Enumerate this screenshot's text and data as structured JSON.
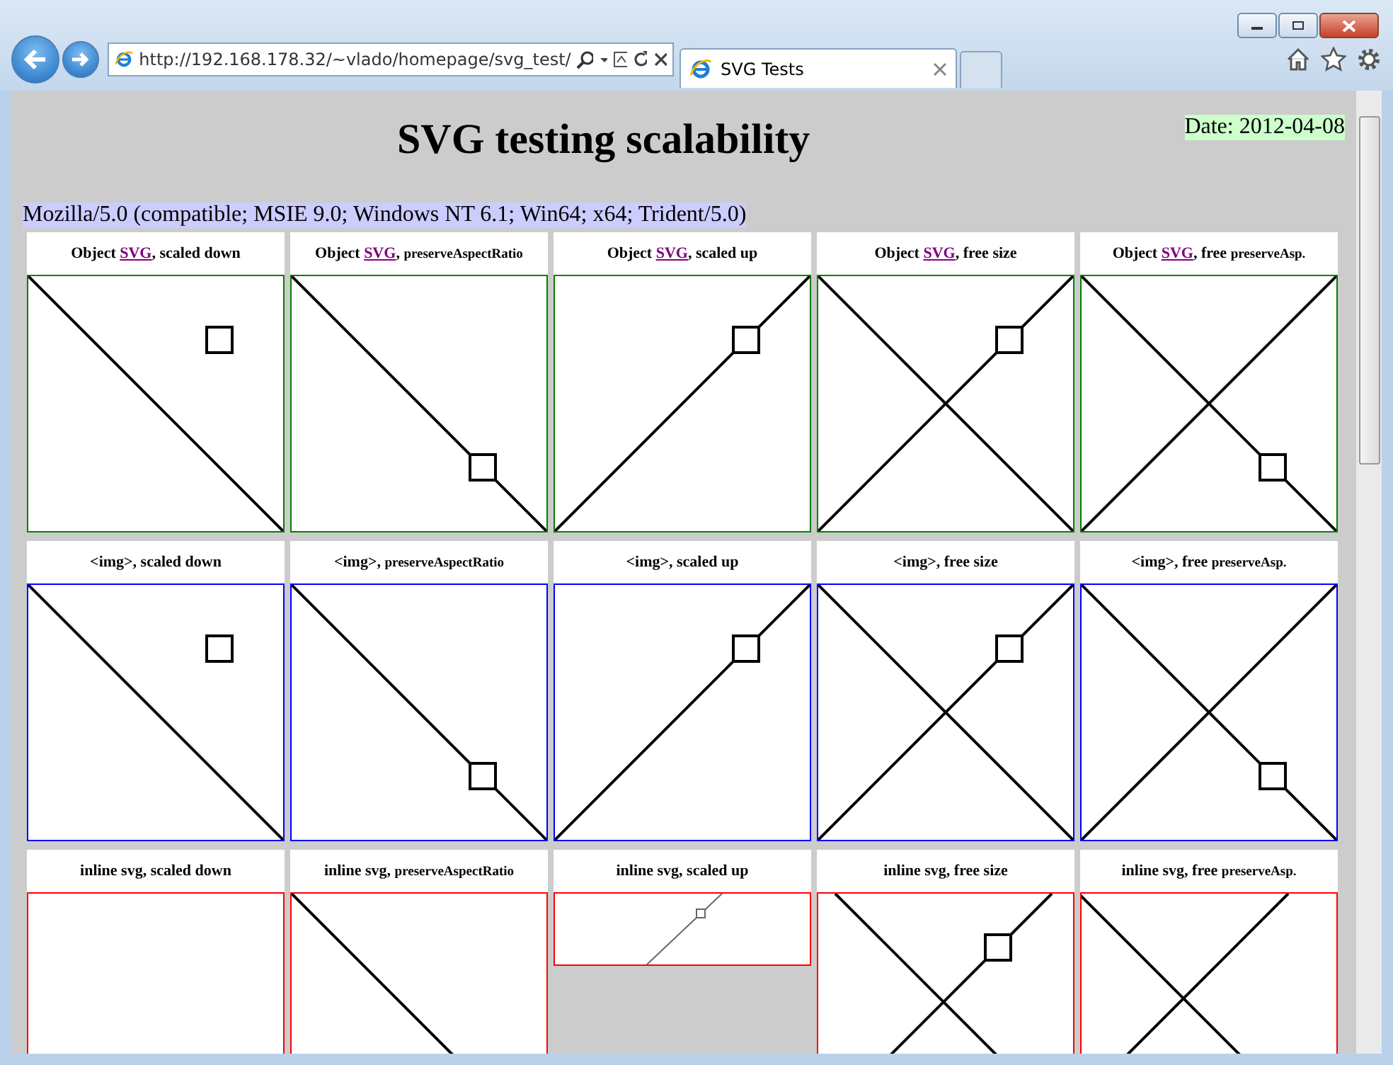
{
  "browser": {
    "url": "http://192.168.178.32/~vlado/homepage/svg_test/",
    "tabs": [
      {
        "title": "SVG Tests",
        "selected": true
      }
    ]
  },
  "page": {
    "title": "SVG testing scalability",
    "date": "Date: 2012-04-08",
    "user_agent": "Mozilla/5.0 (compatible; MSIE 9.0; Windows NT 6.1; Win64; x64; Trident/5.0)",
    "rows": [
      {
        "color": "#008000",
        "cells": [
          {
            "kind": "down",
            "caption": [
              {
                "kind": "text",
                "text": "Object "
              },
              {
                "kind": "link",
                "text": "SVG"
              },
              {
                "kind": "text",
                "text": ", scaled down"
              }
            ]
          },
          {
            "kind": "preserve",
            "caption": [
              {
                "kind": "text",
                "text": "Object "
              },
              {
                "kind": "link",
                "text": "SVG"
              },
              {
                "kind": "text",
                "text": ", "
              },
              {
                "kind": "small",
                "text": "preserveAspectRatio"
              }
            ]
          },
          {
            "kind": "up",
            "caption": [
              {
                "kind": "text",
                "text": "Object "
              },
              {
                "kind": "link",
                "text": "SVG"
              },
              {
                "kind": "text",
                "text": ", scaled up"
              }
            ]
          },
          {
            "kind": "free",
            "caption": [
              {
                "kind": "text",
                "text": "Object "
              },
              {
                "kind": "link",
                "text": "SVG"
              },
              {
                "kind": "text",
                "text": ", free size"
              }
            ]
          },
          {
            "kind": "free-preserve",
            "caption": [
              {
                "kind": "text",
                "text": "Object "
              },
              {
                "kind": "link",
                "text": "SVG"
              },
              {
                "kind": "text",
                "text": ", free "
              },
              {
                "kind": "small",
                "text": "preserveAsp."
              }
            ]
          }
        ]
      },
      {
        "color": "#0000ff",
        "cells": [
          {
            "kind": "down",
            "caption": [
              {
                "kind": "text",
                "text": "<img>, scaled down"
              }
            ]
          },
          {
            "kind": "preserve",
            "caption": [
              {
                "kind": "text",
                "text": "<img>, "
              },
              {
                "kind": "small",
                "text": "preserveAspectRatio"
              }
            ]
          },
          {
            "kind": "up",
            "caption": [
              {
                "kind": "text",
                "text": "<img>, scaled up"
              }
            ]
          },
          {
            "kind": "free",
            "caption": [
              {
                "kind": "text",
                "text": "<img>, free size"
              }
            ]
          },
          {
            "kind": "free-preserve",
            "caption": [
              {
                "kind": "text",
                "text": "<img>, free "
              },
              {
                "kind": "small",
                "text": "preserveAsp."
              }
            ]
          }
        ]
      },
      {
        "color": "#ff0000",
        "cells": [
          {
            "kind": "empty",
            "caption": [
              {
                "kind": "text",
                "text": "inline svg, scaled down"
              }
            ]
          },
          {
            "kind": "preserve",
            "caption": [
              {
                "kind": "text",
                "text": "inline svg, "
              },
              {
                "kind": "small",
                "text": "preserveAspectRatio"
              }
            ]
          },
          {
            "kind": "thin-up",
            "caption": [
              {
                "kind": "text",
                "text": "inline svg, scaled up"
              }
            ]
          },
          {
            "kind": "free-inset",
            "caption": [
              {
                "kind": "text",
                "text": "inline svg, free size"
              }
            ]
          },
          {
            "kind": "free-inset-preserve",
            "caption": [
              {
                "kind": "text",
                "text": "inline svg, free "
              },
              {
                "kind": "small",
                "text": "preserveAsp."
              }
            ]
          }
        ]
      }
    ]
  }
}
